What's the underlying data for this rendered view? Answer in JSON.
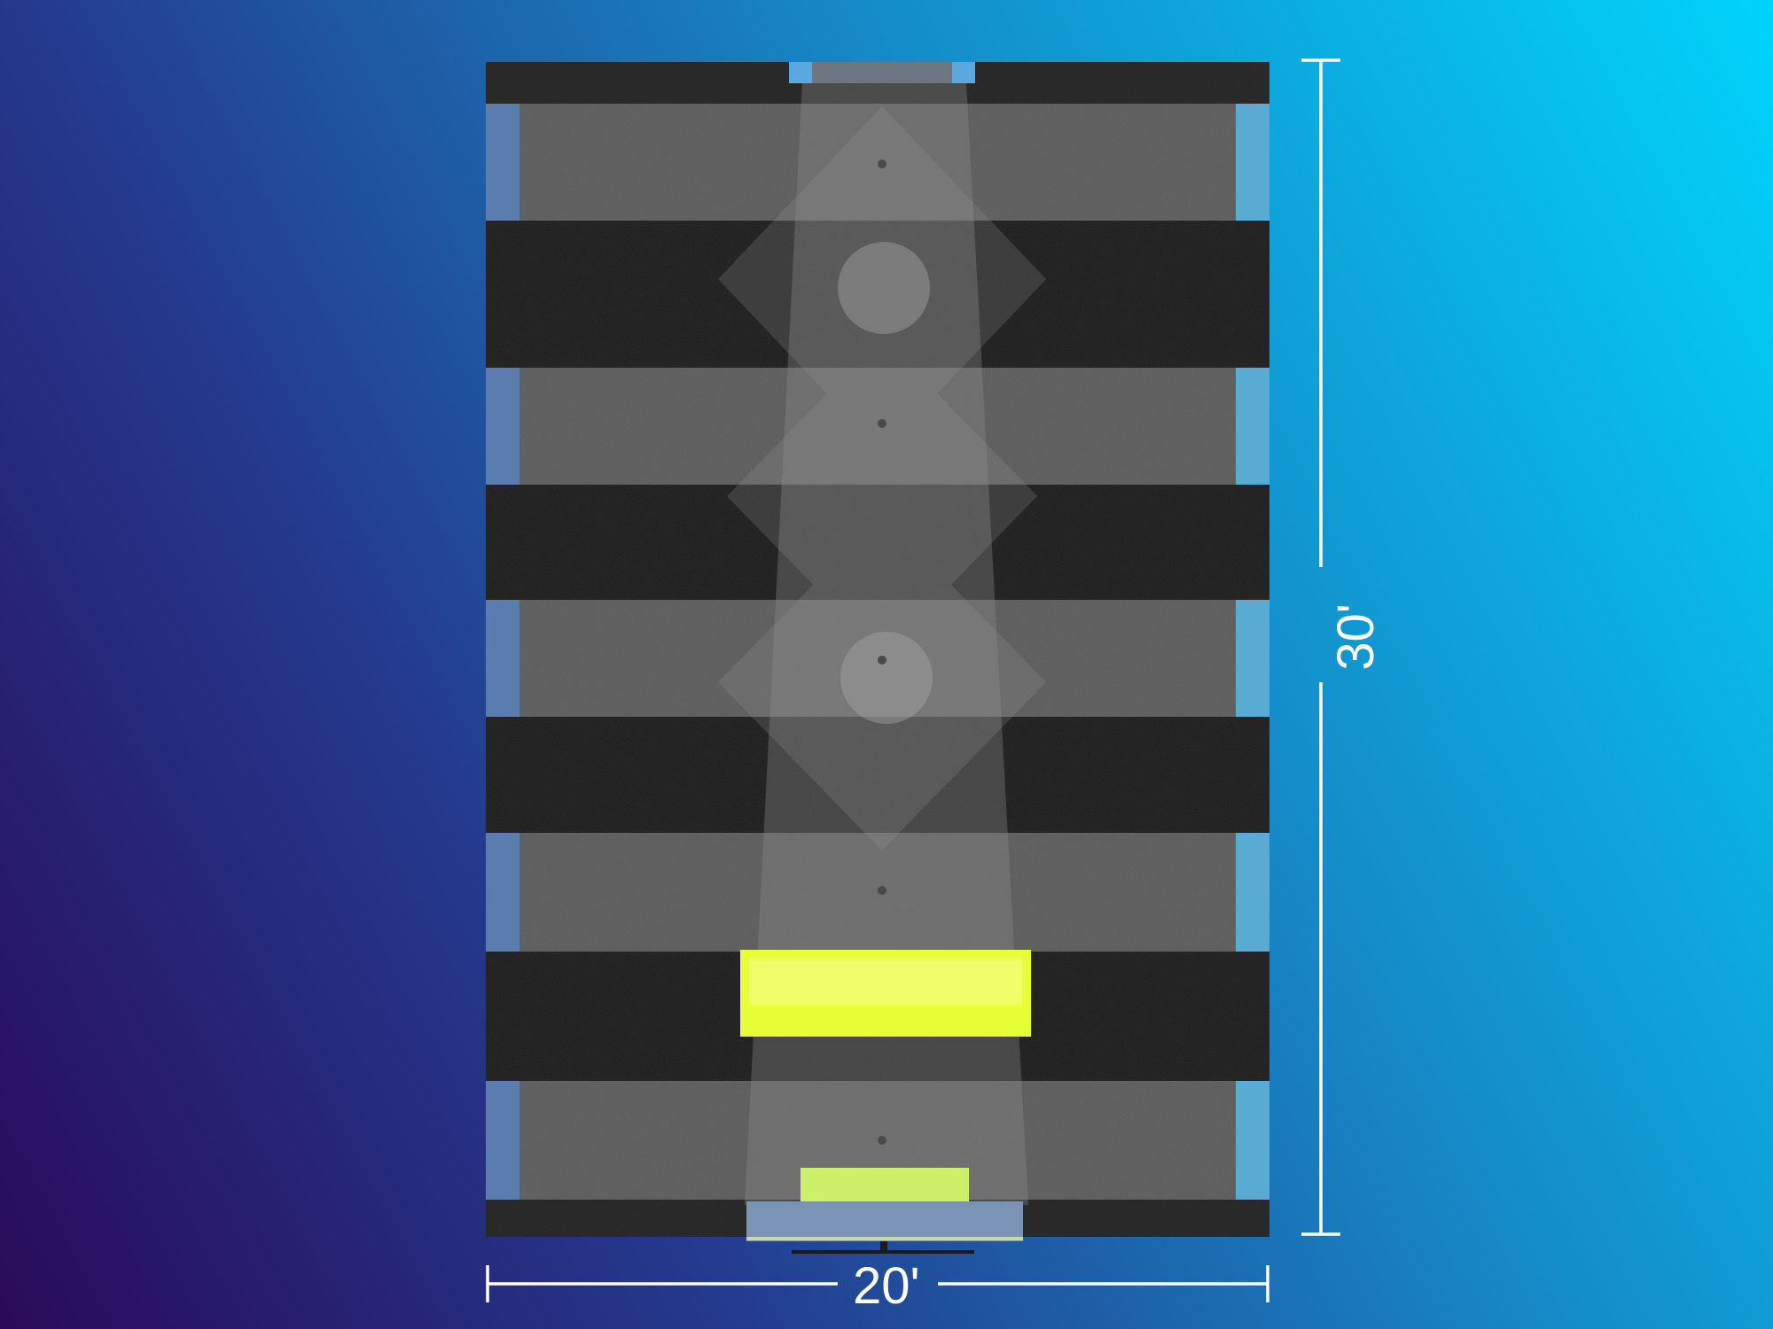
{
  "dimensions": {
    "width_label": "20'",
    "length_label": "30'"
  },
  "colors": {
    "dark_band": "#353535",
    "light_band": "#6e6e6e",
    "accent_light": "#e8ff3a",
    "accent_light_small": "#d6ff5a",
    "side_light": "#5a9fd8",
    "dimension_line": "#ffffff"
  }
}
